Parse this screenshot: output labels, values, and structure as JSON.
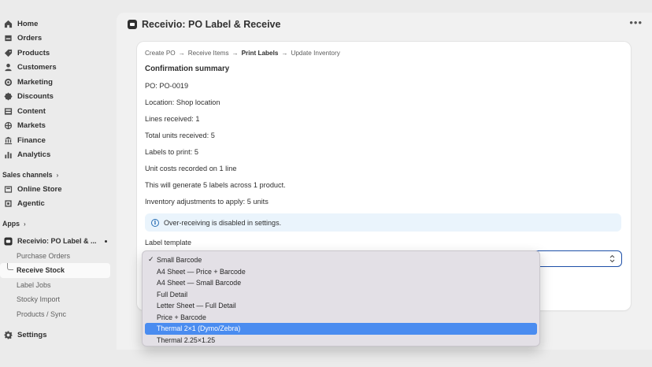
{
  "sidebar": {
    "nav": [
      {
        "label": "Home",
        "icon": "home-icon"
      },
      {
        "label": "Orders",
        "icon": "orders-icon"
      },
      {
        "label": "Products",
        "icon": "tag-icon"
      },
      {
        "label": "Customers",
        "icon": "person-icon"
      },
      {
        "label": "Marketing",
        "icon": "target-icon"
      },
      {
        "label": "Discounts",
        "icon": "discount-icon"
      },
      {
        "label": "Content",
        "icon": "content-icon"
      },
      {
        "label": "Markets",
        "icon": "globe-icon"
      },
      {
        "label": "Finance",
        "icon": "bank-icon"
      },
      {
        "label": "Analytics",
        "icon": "bar-chart-icon"
      }
    ],
    "sales_channels_label": "Sales channels",
    "channels": [
      {
        "label": "Online Store",
        "icon": "store-icon"
      },
      {
        "label": "Agentic",
        "icon": "agentic-icon"
      }
    ],
    "apps_label": "Apps",
    "app": {
      "label": "Receivio: PO Label & ...",
      "icon": "app-icon"
    },
    "app_items": [
      "Purchase Orders",
      "Receive Stock",
      "Label Jobs",
      "Stocky Import",
      "Products / Sync"
    ],
    "settings_label": "Settings"
  },
  "header": {
    "title": "Receivio: PO Label & Receive",
    "more": "•••"
  },
  "card": {
    "breadcrumb": [
      "Create PO",
      "Receive Items",
      "Print Labels",
      "Update Inventory"
    ],
    "summary_title": "Confirmation summary",
    "lines": [
      "PO: PO-0019",
      "Location: Shop location",
      "Lines received: 1",
      "Total units received: 5",
      "Labels to print: 5",
      "Unit costs recorded on 1 line",
      "This will generate 5 labels across 1 product.",
      "Inventory adjustments to apply: 5 units"
    ],
    "banner": "Over-receiving is disabled in settings.",
    "field_label": "Label template"
  },
  "dropdown": {
    "options": [
      "Small Barcode",
      "A4 Sheet — Price + Barcode",
      "A4 Sheet — Small Barcode",
      "Full Detail",
      "Letter Sheet — Full Detail",
      "Price + Barcode",
      "Thermal 2×1 (Dymo/Zebra)",
      "Thermal 2.25×1.25"
    ],
    "checked": "✓",
    "highlight_color": "#4a8cf0"
  }
}
